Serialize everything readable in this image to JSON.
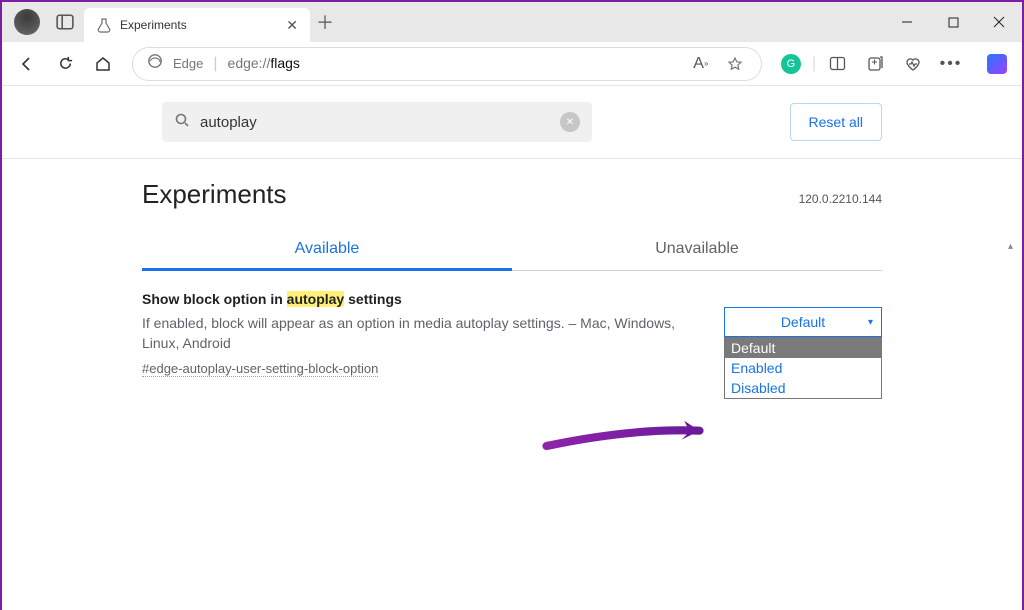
{
  "window": {
    "tab_title": "Experiments"
  },
  "toolbar": {
    "browser_name": "Edge",
    "url_prefix": "edge://",
    "url_path": "flags"
  },
  "search": {
    "value": "autoplay",
    "reset_label": "Reset all"
  },
  "page": {
    "heading": "Experiments",
    "version": "120.0.2210.144",
    "tabs": {
      "available": "Available",
      "unavailable": "Unavailable"
    }
  },
  "flag": {
    "title_pre": "Show block option in ",
    "title_hl": "autoplay",
    "title_post": " settings",
    "description": "If enabled, block will appear as an option in media autoplay settings. – Mac, Windows, Linux, Android",
    "tag": "#edge-autoplay-user-setting-block-option",
    "select_current": "Default",
    "options": [
      "Default",
      "Enabled",
      "Disabled"
    ]
  }
}
